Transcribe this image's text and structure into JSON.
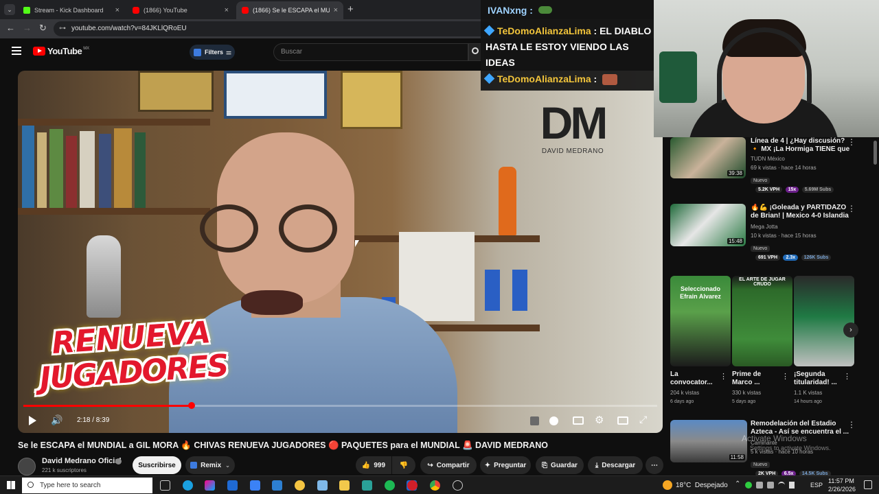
{
  "browser": {
    "tabs": [
      {
        "label": "Stream - Kick Dashboard",
        "active": false
      },
      {
        "label": "(1866) YouTube",
        "active": false
      },
      {
        "label": "(1866) Se le ESCAPA el MUNDI",
        "active": true
      }
    ],
    "url": "youtube.com/watch?v=84JKLlQRoEU",
    "new_tab": "+"
  },
  "youtube": {
    "logo": "YouTube",
    "region": "MX",
    "filters_label": "Filters",
    "search_placeholder": "Buscar"
  },
  "video": {
    "overlay_line1": "RENUEVA",
    "overlay_line2": "JUGADORES",
    "brand_short": "DM",
    "brand_name": "DAVID MEDRANO",
    "time": "2:18 / 8:39",
    "progress": 0.265,
    "title": "Se le ESCAPA el MUNDIAL a GIL MORA 🔥 CHIVAS RENUEVA JUGADORES 🔴 PAQUETES para el MUNDIAL 🚨 DAVID MEDRANO"
  },
  "channel": {
    "name": "David Medrano Oficial",
    "subs": "221 k suscriptores",
    "subscribe": "Suscribirse",
    "remix": "Remix"
  },
  "actions": {
    "likes": "999",
    "share": "Compartir",
    "ask": "Preguntar",
    "save": "Guardar",
    "download": "Descargar"
  },
  "chat": {
    "msg1_user": "IVANxng :",
    "msg2_user": "TeDomoAlianzaLima",
    "msg2_text": ": EL DIABLO HASTA LE ESTOY VIENDO LAS IDEAS",
    "msg3_user": "TeDomoAlianzaLima",
    "msg3_text": ":"
  },
  "sidebar": {
    "videos": [
      {
        "title": "Línea de 4 | ¿Hay discusión? 🔸 MX ¡La Hormiga TIENE que est...",
        "channel": "TUDN México",
        "meta": "69 k vistas · hace 14 horas",
        "badge": "Nuevo",
        "duration": "39:38",
        "vph": "5.2K VPH",
        "x": "15x",
        "subs": "5.69M Subs"
      },
      {
        "title": "🔥💪 ¡Goleada y PARTIDAZO de Brian! | Mexico 4-0 Islandia - ...",
        "channel": "Mega Jotta",
        "meta": "10 k vistas · hace 15 horas",
        "badge": "Nuevo",
        "duration": "15:48",
        "vph": "691 VPH",
        "x": "2.3x",
        "subs": "126K Subs"
      },
      {
        "title": "Remodelación del Estadio Azteca - Así se encuentra el ...",
        "channel": "Caminante",
        "meta": "5 k vistas · hace 10 horas",
        "badge": "Nuevo",
        "duration": "11:58",
        "vph": "2K VPH",
        "x": "6.5x",
        "subs": "14.5K Subs"
      }
    ],
    "shorts": [
      {
        "title": "La convocator...",
        "views": "204 k vistas",
        "ago": "6 days ago",
        "thumb_text": "Seleccionado Efrain Alvarez"
      },
      {
        "title": "Prime de Marco ...",
        "views": "330 k vistas",
        "ago": "5 days ago",
        "thumb_text": "EL ARTE DE JUGAR CRUDO"
      },
      {
        "title": "¡Segunda titularidad! ...",
        "views": "1.1 K vistas",
        "ago": "14 hours ago",
        "thumb_text": ""
      }
    ],
    "activate1": "Activate Windows",
    "activate2": "Settings to activate Windows."
  },
  "taskbar": {
    "search": "Type here to search",
    "weather": "18°C  Despejado",
    "lang": "ESP",
    "time": "11:57 PM",
    "date": "2/26/2026"
  },
  "colors": {
    "yt_red": "#ff0000",
    "chat_user": "#f3c53b",
    "accent_blue": "#3ea6ff"
  }
}
